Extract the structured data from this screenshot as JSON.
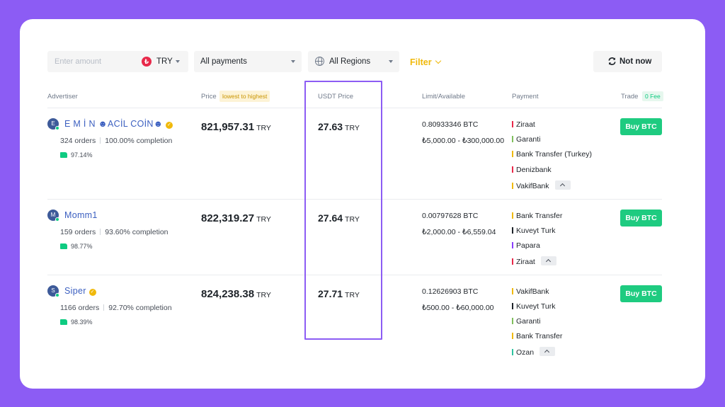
{
  "filters": {
    "amount_placeholder": "Enter amount",
    "currency": "TRY",
    "currency_symbol": "₺",
    "payments": "All payments",
    "regions": "All Regions",
    "filter": "Filter",
    "not_now": "Not now"
  },
  "headers": {
    "advertiser": "Advertiser",
    "price": "Price",
    "sort": "lowest to highest",
    "usdt_price": "USDT Price",
    "limit": "Limit/Available",
    "payment": "Payment",
    "trade": "Trade",
    "fee": "0 Fee"
  },
  "rows": [
    {
      "initial": "E",
      "name": "E M İ N ☻ACİL COİN☻",
      "orders": "324 orders",
      "completion": "100.00% completion",
      "rating": "97.14%",
      "price": "821,957.31",
      "price_unit": "TRY",
      "usdt": "27.63",
      "usdt_unit": "TRY",
      "available": "0.80933346 BTC",
      "limit": "₺5,000.00 - ₺300,000.00",
      "payments": [
        "Ziraat",
        "Garanti",
        "Bank Transfer (Turkey)",
        "Denizbank",
        "VakifBank"
      ],
      "buy": "Buy BTC"
    },
    {
      "initial": "M",
      "name": "Momm1",
      "orders": "159 orders",
      "completion": "93.60% completion",
      "rating": "98.77%",
      "price": "822,319.27",
      "price_unit": "TRY",
      "usdt": "27.64",
      "usdt_unit": "TRY",
      "available": "0.00797628 BTC",
      "limit": "₺2,000.00 - ₺6,559.04",
      "payments": [
        "Bank Transfer",
        "Kuveyt Turk",
        "Papara",
        "Ziraat"
      ],
      "buy": "Buy BTC"
    },
    {
      "initial": "S",
      "name": "Siper",
      "orders": "1166 orders",
      "completion": "92.70% completion",
      "rating": "98.39%",
      "price": "824,238.38",
      "price_unit": "TRY",
      "usdt": "27.71",
      "usdt_unit": "TRY",
      "available": "0.12626903 BTC",
      "limit": "₺500.00 - ₺60,000.00",
      "payments": [
        "VakifBank",
        "Kuveyt Turk",
        "Garanti",
        "Bank Transfer",
        "Ozan"
      ],
      "buy": "Buy BTC"
    }
  ],
  "colors": {
    "accent": "#f0b90b",
    "buy": "#1ecb80",
    "highlight": "#8c5cf4",
    "bar_red": "#e8294a",
    "bar_green": "#7fbf5c",
    "bar_orange": "#f0b90b",
    "bar_dark": "#1e2329",
    "bar_purple": "#8a3ffc",
    "bar_teal": "#2ec4a0"
  }
}
